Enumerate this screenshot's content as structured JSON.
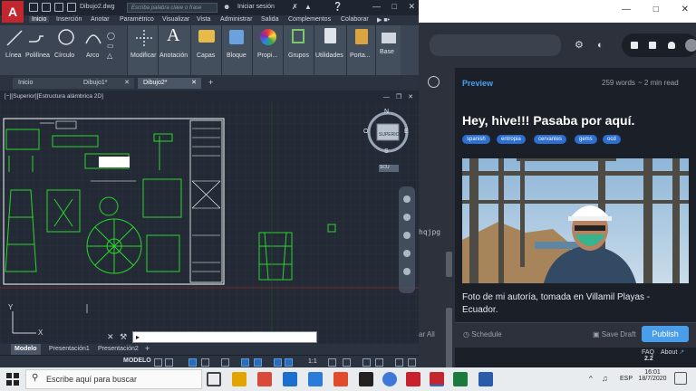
{
  "acad": {
    "logo": "A",
    "doc_name": "Dibujo2.dwg",
    "search_placeholder": "Escriba palabra clave o frase",
    "signin": "Iniciar sesión",
    "ribbon_tabs": [
      "Inicio",
      "Inserción",
      "Anotar",
      "Paramétrico",
      "Visualizar",
      "Vista",
      "Administrar",
      "Salida",
      "Complementos",
      "Colaborar"
    ],
    "ribbon_buttons": [
      "Línea",
      "Polilínea",
      "Círculo",
      "Arco",
      "Modificar",
      "Anotación",
      "Capas",
      "Bloque",
      "Propi...",
      "Grupos",
      "Utilidades",
      "Porta...",
      "Base"
    ],
    "file_tabs": [
      "Inicio",
      "Dibujo1*",
      "Dibujo2*"
    ],
    "viewport_label": "[−][Superior][Estructura alámbrica 2D]",
    "viewcube_top": "SUPERIOR",
    "viewcube_n": "N",
    "viewcube_s": "S",
    "viewcube_e": "E",
    "viewcube_o": "O",
    "ucs_label": "SCU",
    "layout_tabs": [
      "Modelo",
      "Presentación1",
      "Presentación2"
    ],
    "status_model": "MODELO",
    "status_scale": "1:1"
  },
  "browser": {
    "preview_label": "Preview",
    "words": "259 words",
    "read_time": "~ 2 min read",
    "post_title": "Hey, hive!!! Pasaba por aquí.",
    "tags": [
      "spanish",
      "entropia",
      "cervantes",
      "gems",
      "ocd"
    ],
    "caption": "Foto de mi autoría, tomada en Villamil Playas - Ecuador.",
    "left_fragment": "hqjpg",
    "left_bottom": "ar All",
    "schedule": "Schedule",
    "save_draft": "Save Draft",
    "publish": "Publish",
    "faq": "FAQ",
    "about": "About",
    "version": "2.2"
  },
  "taskbar": {
    "search_text": "Escribe aquí para buscar",
    "lang": "ESP",
    "time": "16:01",
    "date": "18/7/2020"
  },
  "colors": {
    "accent": "#4a9de8",
    "acad_red": "#c3262c",
    "cad_green": "#2bd62b"
  }
}
